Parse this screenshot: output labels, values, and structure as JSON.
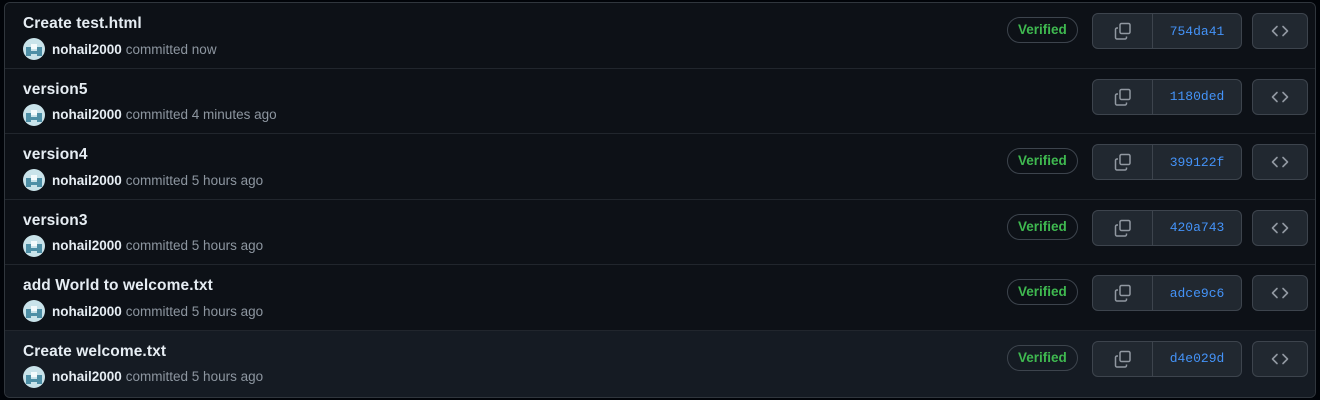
{
  "commits": [
    {
      "title": "Create test.html",
      "author": "nohail2000",
      "when": "committed now",
      "verified": true,
      "badge": "Verified",
      "sha": "754da41"
    },
    {
      "title": "version5",
      "author": "nohail2000",
      "when": "committed 4 minutes ago",
      "verified": false,
      "badge": "",
      "sha": "1180ded"
    },
    {
      "title": "version4",
      "author": "nohail2000",
      "when": "committed 5 hours ago",
      "verified": true,
      "badge": "Verified",
      "sha": "399122f"
    },
    {
      "title": "version3",
      "author": "nohail2000",
      "when": "committed 5 hours ago",
      "verified": true,
      "badge": "Verified",
      "sha": "420a743"
    },
    {
      "title": "add World to welcome.txt",
      "author": "nohail2000",
      "when": "committed 5 hours ago",
      "verified": true,
      "badge": "Verified",
      "sha": "adce9c6"
    },
    {
      "title": "Create welcome.txt",
      "author": "nohail2000",
      "when": "committed 5 hours ago",
      "verified": true,
      "badge": "Verified",
      "sha": "d4e029d"
    }
  ],
  "icons": {
    "copy": "copy-icon",
    "browse": "code-icon",
    "avatar": "avatar-identicon"
  },
  "colors": {
    "background": "#0d1117",
    "verified": "#3fb950",
    "sha_link": "#4493f8",
    "text": "#e6edf3",
    "muted": "#8d96a0"
  }
}
